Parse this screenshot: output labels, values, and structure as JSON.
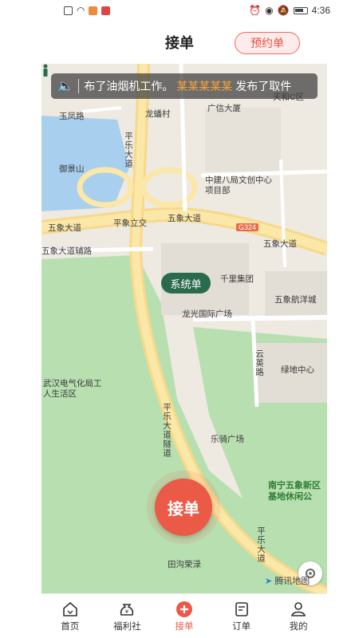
{
  "status_bar": {
    "time": "4:36"
  },
  "header": {
    "title": "接单",
    "reserve_label": "预约单"
  },
  "notice": {
    "text_before": "布了油烟机工作。",
    "highlight": "某某某某某",
    "text_after": "发布了取件"
  },
  "map": {
    "labels": {
      "yufeng_road": "玉凤路",
      "yujing_mountain": "御景山",
      "longbo_village": "龙蟠村",
      "guangxin": "广信大厦",
      "tianhe": "天和C区",
      "zhongjian": "中建八局文创中心项目部",
      "pingle_1": "平乐大道",
      "pingxiang": "平象立交",
      "wuxiang_1": "五象大道",
      "wuxiang_2": "五象大道",
      "wuxiang_3": "五象大道",
      "wuxiang_aux": "五象大道辅路",
      "g324": "G324",
      "qianli": "千里集团",
      "longguang": "龙光国际广场",
      "wuxiang_hang": "五象航洋城",
      "yunying": "云英路",
      "lvdi": "绿地中心",
      "wuhan_electric": "武汉电气化局工人生活区",
      "pingle_tunnel": "平乐大道隧道",
      "leqi": "乐骑广场",
      "nanning_base": "南宁五象新区基地休闲公",
      "pingle_2": "平乐大道",
      "tiangou": "田沟荣渌",
      "tencent": "腾讯地图"
    },
    "pin_label": "系统单",
    "accept_label": "接单"
  },
  "tabbar": {
    "items": [
      {
        "label": "首页"
      },
      {
        "label": "福利社"
      },
      {
        "label": "接单"
      },
      {
        "label": "订单"
      },
      {
        "label": "我的"
      }
    ]
  },
  "colors": {
    "accent": "#ea5a47",
    "pin": "#2a6b4e",
    "park": "#b7dfb0"
  }
}
